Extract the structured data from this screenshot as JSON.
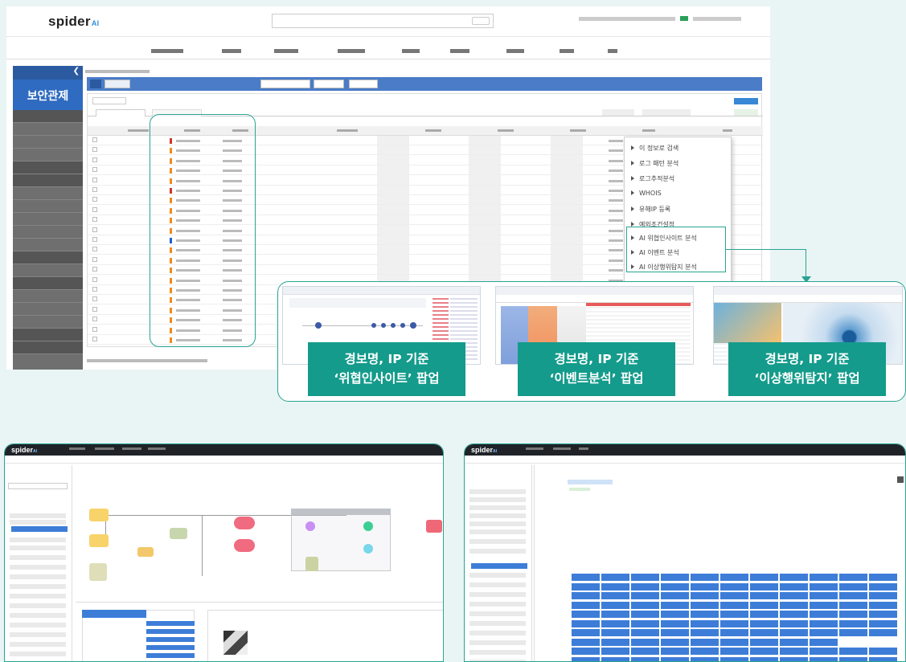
{
  "main_screenshot": {
    "logo_text": "spider",
    "logo_suffix": "AI",
    "sidebar_title": "보안관제",
    "context_menu": {
      "items": [
        "이 정보로 검색",
        "로그 패턴 분석",
        "로그추적분석",
        "WHOIS",
        "유해IP 등록",
        "예외조건설정",
        "AI 위협인사이트 분석",
        "AI 이벤트 분석",
        "AI 이상행위탐지 분석"
      ]
    }
  },
  "popups": [
    {
      "line1": "경보명, IP 기준",
      "line2": "‘위협인사이트’ 팝업"
    },
    {
      "line1": "경보명, IP 기준",
      "line2": "‘이벤트분석’ 팝업"
    },
    {
      "line1": "경보명, IP 기준",
      "line2": "‘이상행위탐지’ 팝업"
    }
  ],
  "bottom_left": {
    "logo_text": "spider",
    "logo_suffix": "AI"
  },
  "bottom_right": {
    "logo_text": "spider",
    "logo_suffix": "AI"
  },
  "colors": {
    "accent_teal": "#149b8b",
    "frame_teal": "#29a394",
    "toolbar_blue": "#4a7cc7",
    "critical": "#d0352a",
    "warning": "#f08a1c",
    "info": "#1d5fd0"
  }
}
